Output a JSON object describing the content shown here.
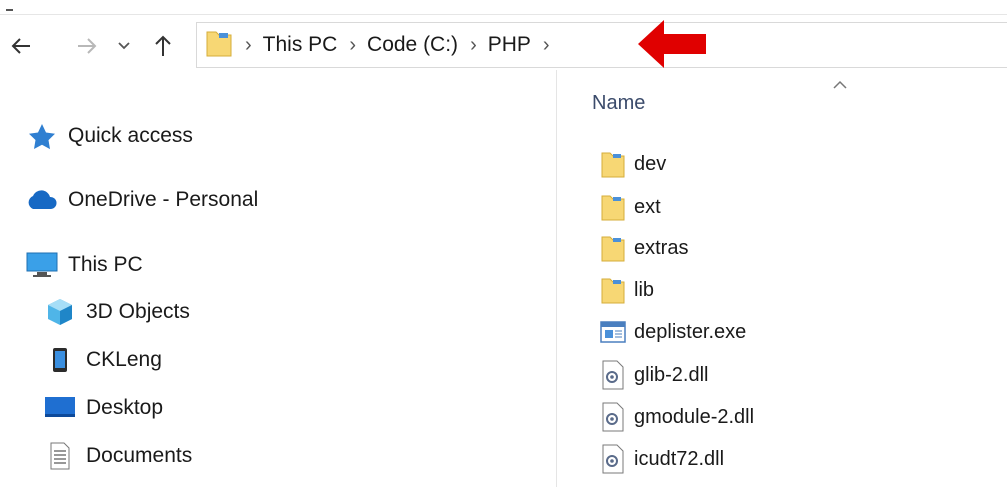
{
  "address": {
    "crumbs": [
      "This PC",
      "Code (C:)",
      "PHP"
    ]
  },
  "nav_pane": {
    "items": [
      {
        "label": "Quick access",
        "icon": "star-icon"
      },
      {
        "label": "OneDrive - Personal",
        "icon": "cloud-icon"
      },
      {
        "label": "This PC",
        "icon": "computer-icon"
      },
      {
        "label": "3D Objects",
        "icon": "cube-icon"
      },
      {
        "label": "CKLeng",
        "icon": "phone-icon"
      },
      {
        "label": "Desktop",
        "icon": "desktop-icon"
      },
      {
        "label": "Documents",
        "icon": "document-icon"
      }
    ]
  },
  "file_list": {
    "column_name": "Name",
    "files": [
      {
        "name": "dev",
        "type": "folder"
      },
      {
        "name": "ext",
        "type": "folder"
      },
      {
        "name": "extras",
        "type": "folder"
      },
      {
        "name": "lib",
        "type": "folder"
      },
      {
        "name": "deplister.exe",
        "type": "exe"
      },
      {
        "name": "glib-2.dll",
        "type": "dll"
      },
      {
        "name": "gmodule-2.dll",
        "type": "dll"
      },
      {
        "name": "icudt72.dll",
        "type": "dll"
      }
    ]
  },
  "colors": {
    "folder": "#f7d774",
    "accent": "#0078d4",
    "arrow": "#e00000"
  }
}
